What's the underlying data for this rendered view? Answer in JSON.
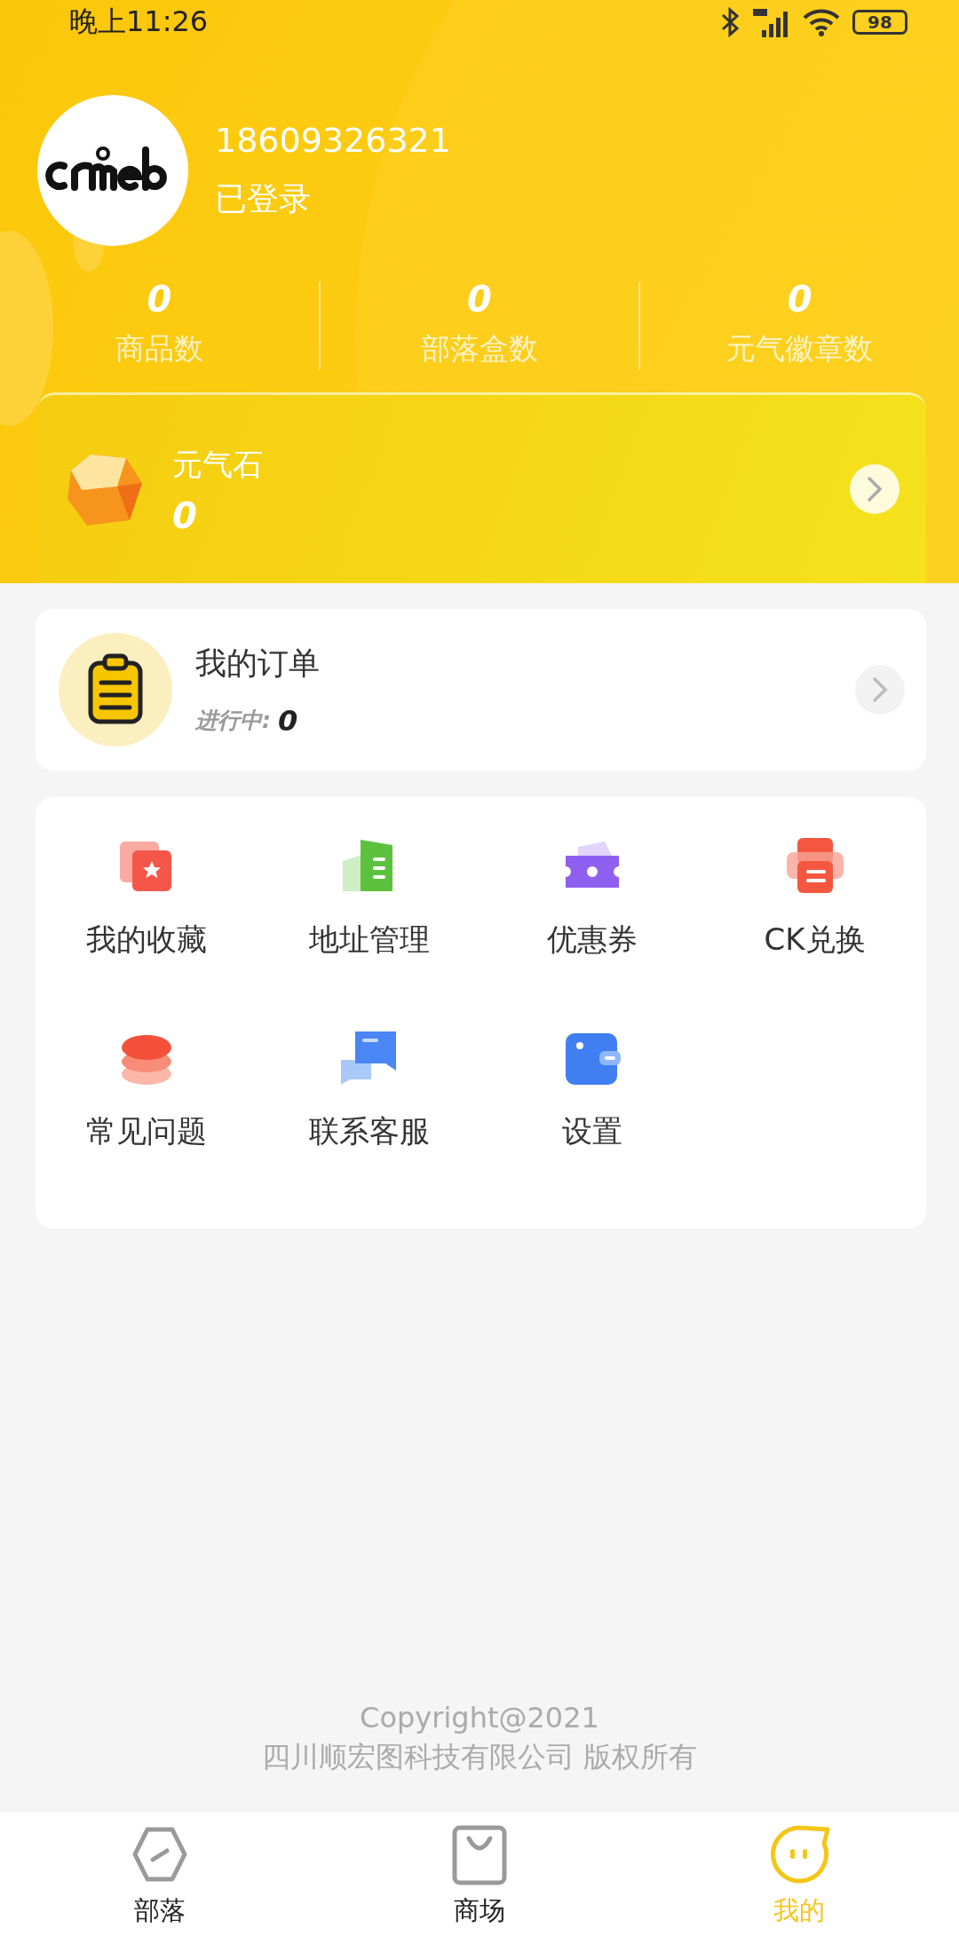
{
  "status_bar": {
    "time": "晚上11:26",
    "battery": "98"
  },
  "profile": {
    "phone": "18609326321",
    "status": "已登录"
  },
  "stats": [
    {
      "value": "0",
      "label": "商品数"
    },
    {
      "value": "0",
      "label": "部落盒数"
    },
    {
      "value": "0",
      "label": "元气徽章数"
    }
  ],
  "energy_card": {
    "title": "元气石",
    "value": "0"
  },
  "order_card": {
    "title": "我的订单",
    "progress_label": "进行中:",
    "progress_value": "0"
  },
  "menu": [
    {
      "label": "我的收藏"
    },
    {
      "label": "地址管理"
    },
    {
      "label": "优惠券"
    },
    {
      "label": "CK兑换"
    },
    {
      "label": "常见问题"
    },
    {
      "label": "联系客服"
    },
    {
      "label": "设置"
    }
  ],
  "footer": {
    "copyright": "Copyright@2021",
    "company": "四川顺宏图科技有限公司 版权所有"
  },
  "tab_bar": [
    {
      "label": "部落",
      "selected": false
    },
    {
      "label": "商场",
      "selected": false
    },
    {
      "label": "我的",
      "selected": true
    }
  ]
}
